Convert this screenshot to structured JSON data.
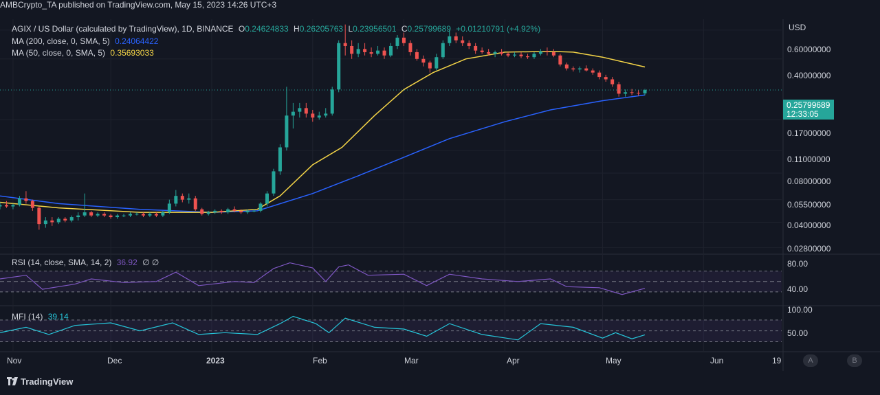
{
  "header": {
    "publish_text": "AMBCrypto_TA published on TradingView.com, May 15, 2023 14:26 UTC+3"
  },
  "legend": {
    "symbol": "AGIX / US Dollar (calculated by TradingView), 1D, BINANCE",
    "o_key": "O",
    "o_val": "0.24624833",
    "h_key": "H",
    "h_val": "0.26205763",
    "l_key": "L",
    "l_val": "0.23956501",
    "c_key": "C",
    "c_val": "0.25799689",
    "change": "+0.01210791 (+4.92%)",
    "ma200_label": "MA (200, close, 0, SMA, 5)",
    "ma200_val": "0.24064422",
    "ma50_label": "MA (50, close, 0, SMA, 5)",
    "ma50_val": "0.35693033"
  },
  "rsi": {
    "label": "RSI (14, close, SMA, 14, 2)",
    "value": "36.92",
    "extra": "∅ ∅"
  },
  "mfi": {
    "label": "MFI (14)",
    "value": "39.14"
  },
  "price_axis": {
    "currency": "USD",
    "ticks": [
      "0.60000000",
      "0.40000000",
      "0.17000000",
      "0.11000000",
      "0.08000000",
      "0.05500000",
      "0.04000000",
      "0.02800000"
    ],
    "current_price": "0.25799689",
    "countdown": "12:33:05"
  },
  "rsi_axis": {
    "ticks": [
      "80.00",
      "40.00"
    ]
  },
  "mfi_axis": {
    "ticks": [
      "100.00",
      "50.00"
    ]
  },
  "time_axis": {
    "ticks": [
      "Nov",
      "Dec",
      "2023",
      "Feb",
      "Mar",
      "Apr",
      "May",
      "Jun",
      "19"
    ]
  },
  "buttons": {
    "a": "A",
    "b": "B"
  },
  "branding": {
    "logo_text": "TradingView"
  },
  "colors": {
    "up": "#26a69a",
    "down": "#ef5350",
    "ma200": "#2962ff",
    "ma50": "#f5d547",
    "rsi": "#7e57c2",
    "mfi": "#26c6da",
    "background": "#131722"
  },
  "chart_data": {
    "type": "candlestick",
    "scale": "log",
    "ylim": [
      0.026,
      0.7
    ],
    "x_range": [
      "2022-10-28",
      "2023-06-25"
    ],
    "ohlc": [
      [
        "2022-10-28",
        0.05,
        0.053,
        0.048,
        0.051
      ],
      [
        "2022-10-30",
        0.051,
        0.054,
        0.049,
        0.05
      ],
      [
        "2022-11-01",
        0.05,
        0.052,
        0.048,
        0.051
      ],
      [
        "2022-11-03",
        0.051,
        0.058,
        0.05,
        0.056
      ],
      [
        "2022-11-05",
        0.056,
        0.062,
        0.052,
        0.054
      ],
      [
        "2022-11-07",
        0.054,
        0.055,
        0.047,
        0.049
      ],
      [
        "2022-11-09",
        0.049,
        0.05,
        0.036,
        0.039
      ],
      [
        "2022-11-11",
        0.039,
        0.043,
        0.037,
        0.041
      ],
      [
        "2022-11-13",
        0.041,
        0.043,
        0.038,
        0.04
      ],
      [
        "2022-11-15",
        0.04,
        0.043,
        0.039,
        0.042
      ],
      [
        "2022-11-17",
        0.042,
        0.043,
        0.04,
        0.041
      ],
      [
        "2022-11-19",
        0.041,
        0.044,
        0.04,
        0.043
      ],
      [
        "2022-11-21",
        0.043,
        0.046,
        0.041,
        0.044
      ],
      [
        "2022-11-23",
        0.044,
        0.06,
        0.043,
        0.046
      ],
      [
        "2022-11-25",
        0.046,
        0.047,
        0.043,
        0.044
      ],
      [
        "2022-11-27",
        0.044,
        0.046,
        0.043,
        0.045
      ],
      [
        "2022-11-29",
        0.045,
        0.046,
        0.043,
        0.044
      ],
      [
        "2022-12-01",
        0.044,
        0.045,
        0.042,
        0.043
      ],
      [
        "2022-12-03",
        0.043,
        0.045,
        0.042,
        0.044
      ],
      [
        "2022-12-05",
        0.044,
        0.045,
        0.043,
        0.044
      ],
      [
        "2022-12-07",
        0.044,
        0.046,
        0.043,
        0.045
      ],
      [
        "2022-12-09",
        0.045,
        0.046,
        0.044,
        0.045
      ],
      [
        "2022-12-11",
        0.045,
        0.046,
        0.043,
        0.044
      ],
      [
        "2022-12-13",
        0.044,
        0.046,
        0.043,
        0.045
      ],
      [
        "2022-12-15",
        0.045,
        0.046,
        0.043,
        0.044
      ],
      [
        "2022-12-17",
        0.044,
        0.047,
        0.043,
        0.046
      ],
      [
        "2022-12-19",
        0.046,
        0.055,
        0.045,
        0.052
      ],
      [
        "2022-12-21",
        0.052,
        0.063,
        0.05,
        0.058
      ],
      [
        "2022-12-23",
        0.058,
        0.06,
        0.053,
        0.055
      ],
      [
        "2022-12-25",
        0.055,
        0.06,
        0.052,
        0.056
      ],
      [
        "2022-12-27",
        0.056,
        0.058,
        0.047,
        0.048
      ],
      [
        "2022-12-29",
        0.048,
        0.049,
        0.044,
        0.045
      ],
      [
        "2022-12-31",
        0.045,
        0.047,
        0.044,
        0.046
      ],
      [
        "2023-01-02",
        0.046,
        0.048,
        0.045,
        0.047
      ],
      [
        "2023-01-04",
        0.047,
        0.048,
        0.045,
        0.046
      ],
      [
        "2023-01-06",
        0.046,
        0.049,
        0.045,
        0.048
      ],
      [
        "2023-01-08",
        0.048,
        0.05,
        0.046,
        0.047
      ],
      [
        "2023-01-10",
        0.047,
        0.048,
        0.045,
        0.046
      ],
      [
        "2023-01-12",
        0.046,
        0.048,
        0.045,
        0.047
      ],
      [
        "2023-01-14",
        0.047,
        0.048,
        0.046,
        0.047
      ],
      [
        "2023-01-16",
        0.047,
        0.053,
        0.046,
        0.052
      ],
      [
        "2023-01-18",
        0.052,
        0.062,
        0.05,
        0.06
      ],
      [
        "2023-01-20",
        0.06,
        0.085,
        0.058,
        0.082
      ],
      [
        "2023-01-22",
        0.082,
        0.12,
        0.078,
        0.115
      ],
      [
        "2023-01-24",
        0.115,
        0.27,
        0.11,
        0.18
      ],
      [
        "2023-01-26",
        0.18,
        0.215,
        0.15,
        0.19
      ],
      [
        "2023-01-28",
        0.19,
        0.215,
        0.175,
        0.2
      ],
      [
        "2023-01-30",
        0.2,
        0.215,
        0.175,
        0.185
      ],
      [
        "2023-02-01",
        0.185,
        0.195,
        0.165,
        0.175
      ],
      [
        "2023-02-03",
        0.175,
        0.19,
        0.17,
        0.18
      ],
      [
        "2023-02-05",
        0.18,
        0.2,
        0.175,
        0.185
      ],
      [
        "2023-02-07",
        0.185,
        0.27,
        0.18,
        0.26
      ],
      [
        "2023-02-09",
        0.26,
        0.52,
        0.25,
        0.5
      ],
      [
        "2023-02-11",
        0.5,
        0.65,
        0.42,
        0.48
      ],
      [
        "2023-02-13",
        0.48,
        0.52,
        0.4,
        0.43
      ],
      [
        "2023-02-15",
        0.43,
        0.5,
        0.41,
        0.46
      ],
      [
        "2023-02-17",
        0.46,
        0.5,
        0.42,
        0.44
      ],
      [
        "2023-02-19",
        0.44,
        0.47,
        0.41,
        0.43
      ],
      [
        "2023-02-21",
        0.43,
        0.48,
        0.42,
        0.45
      ],
      [
        "2023-02-23",
        0.45,
        0.47,
        0.4,
        0.42
      ],
      [
        "2023-02-25",
        0.42,
        0.5,
        0.41,
        0.48
      ],
      [
        "2023-02-27",
        0.48,
        0.56,
        0.46,
        0.54
      ],
      [
        "2023-03-01",
        0.54,
        0.58,
        0.48,
        0.5
      ],
      [
        "2023-03-03",
        0.5,
        0.52,
        0.42,
        0.44
      ],
      [
        "2023-03-05",
        0.44,
        0.46,
        0.39,
        0.4
      ],
      [
        "2023-03-07",
        0.4,
        0.42,
        0.36,
        0.38
      ],
      [
        "2023-03-09",
        0.38,
        0.39,
        0.33,
        0.35
      ],
      [
        "2023-03-11",
        0.35,
        0.43,
        0.34,
        0.41
      ],
      [
        "2023-03-13",
        0.41,
        0.52,
        0.4,
        0.5
      ],
      [
        "2023-03-15",
        0.5,
        0.6,
        0.48,
        0.55
      ],
      [
        "2023-03-17",
        0.55,
        0.58,
        0.5,
        0.52
      ],
      [
        "2023-03-19",
        0.52,
        0.55,
        0.48,
        0.5
      ],
      [
        "2023-03-21",
        0.5,
        0.52,
        0.46,
        0.48
      ],
      [
        "2023-03-23",
        0.48,
        0.5,
        0.43,
        0.45
      ],
      [
        "2023-03-25",
        0.45,
        0.47,
        0.43,
        0.44
      ],
      [
        "2023-03-27",
        0.44,
        0.46,
        0.42,
        0.43
      ],
      [
        "2023-03-29",
        0.43,
        0.45,
        0.41,
        0.44
      ],
      [
        "2023-03-31",
        0.44,
        0.46,
        0.42,
        0.43
      ],
      [
        "2023-04-02",
        0.43,
        0.44,
        0.41,
        0.42
      ],
      [
        "2023-04-04",
        0.42,
        0.44,
        0.41,
        0.425
      ],
      [
        "2023-04-06",
        0.425,
        0.44,
        0.405,
        0.415
      ],
      [
        "2023-04-08",
        0.415,
        0.43,
        0.4,
        0.41
      ],
      [
        "2023-04-10",
        0.41,
        0.44,
        0.4,
        0.43
      ],
      [
        "2023-04-12",
        0.43,
        0.46,
        0.42,
        0.445
      ],
      [
        "2023-04-14",
        0.445,
        0.47,
        0.42,
        0.44
      ],
      [
        "2023-04-16",
        0.44,
        0.46,
        0.41,
        0.42
      ],
      [
        "2023-04-18",
        0.42,
        0.43,
        0.36,
        0.37
      ],
      [
        "2023-04-20",
        0.37,
        0.38,
        0.34,
        0.35
      ],
      [
        "2023-04-22",
        0.35,
        0.36,
        0.335,
        0.345
      ],
      [
        "2023-04-24",
        0.345,
        0.36,
        0.33,
        0.35
      ],
      [
        "2023-04-26",
        0.35,
        0.365,
        0.335,
        0.34
      ],
      [
        "2023-04-28",
        0.34,
        0.35,
        0.32,
        0.33
      ],
      [
        "2023-04-30",
        0.33,
        0.34,
        0.3,
        0.31
      ],
      [
        "2023-05-02",
        0.31,
        0.32,
        0.29,
        0.3
      ],
      [
        "2023-05-04",
        0.3,
        0.31,
        0.27,
        0.28
      ],
      [
        "2023-05-06",
        0.28,
        0.29,
        0.235,
        0.245
      ],
      [
        "2023-05-08",
        0.245,
        0.26,
        0.235,
        0.25
      ],
      [
        "2023-05-10",
        0.25,
        0.262,
        0.24,
        0.248
      ],
      [
        "2023-05-12",
        0.248,
        0.258,
        0.238,
        0.246
      ],
      [
        "2023-05-14",
        0.24624833,
        0.26205763,
        0.23956501,
        0.25799689
      ]
    ],
    "ma200": [
      [
        "2022-10-28",
        0.058
      ],
      [
        "2022-11-15",
        0.052
      ],
      [
        "2022-12-10",
        0.048
      ],
      [
        "2023-01-01",
        0.046
      ],
      [
        "2023-01-15",
        0.047
      ],
      [
        "2023-02-01",
        0.06
      ],
      [
        "2023-02-15",
        0.077
      ],
      [
        "2023-03-01",
        0.1
      ],
      [
        "2023-03-15",
        0.13
      ],
      [
        "2023-04-01",
        0.165
      ],
      [
        "2023-04-15",
        0.195
      ],
      [
        "2023-05-01",
        0.222
      ],
      [
        "2023-05-14",
        0.24064422
      ]
    ],
    "ma50": [
      [
        "2022-10-28",
        0.053
      ],
      [
        "2022-11-15",
        0.049
      ],
      [
        "2022-12-10",
        0.046
      ],
      [
        "2023-01-01",
        0.046
      ],
      [
        "2023-01-15",
        0.048
      ],
      [
        "2023-01-22",
        0.058
      ],
      [
        "2023-02-01",
        0.09
      ],
      [
        "2023-02-10",
        0.115
      ],
      [
        "2023-02-20",
        0.18
      ],
      [
        "2023-03-01",
        0.26
      ],
      [
        "2023-03-10",
        0.33
      ],
      [
        "2023-03-20",
        0.4
      ],
      [
        "2023-04-01",
        0.44
      ],
      [
        "2023-04-15",
        0.445
      ],
      [
        "2023-04-22",
        0.44
      ],
      [
        "2023-05-01",
        0.41
      ],
      [
        "2023-05-14",
        0.35693033
      ]
    ],
    "rsi_series": [
      [
        "2022-10-28",
        55
      ],
      [
        "2022-11-05",
        62
      ],
      [
        "2022-11-10",
        35
      ],
      [
        "2022-11-20",
        45
      ],
      [
        "2022-11-25",
        55
      ],
      [
        "2022-12-05",
        48
      ],
      [
        "2022-12-15",
        50
      ],
      [
        "2022-12-21",
        68
      ],
      [
        "2022-12-28",
        42
      ],
      [
        "2023-01-08",
        50
      ],
      [
        "2023-01-14",
        48
      ],
      [
        "2023-01-20",
        75
      ],
      [
        "2023-01-25",
        86
      ],
      [
        "2023-02-01",
        76
      ],
      [
        "2023-02-05",
        50
      ],
      [
        "2023-02-09",
        78
      ],
      [
        "2023-02-12",
        82
      ],
      [
        "2023-02-18",
        62
      ],
      [
        "2023-03-01",
        64
      ],
      [
        "2023-03-08",
        42
      ],
      [
        "2023-03-15",
        64
      ],
      [
        "2023-03-25",
        55
      ],
      [
        "2023-04-05",
        50
      ],
      [
        "2023-04-15",
        55
      ],
      [
        "2023-04-20",
        40
      ],
      [
        "2023-04-30",
        38
      ],
      [
        "2023-05-07",
        25
      ],
      [
        "2023-05-14",
        36.92
      ]
    ],
    "mfi_series": [
      [
        "2022-10-28",
        45
      ],
      [
        "2022-11-05",
        60
      ],
      [
        "2022-11-12",
        40
      ],
      [
        "2022-11-20",
        65
      ],
      [
        "2022-12-01",
        72
      ],
      [
        "2022-12-10",
        50
      ],
      [
        "2022-12-20",
        72
      ],
      [
        "2022-12-28",
        40
      ],
      [
        "2023-01-05",
        45
      ],
      [
        "2023-01-15",
        40
      ],
      [
        "2023-01-22",
        70
      ],
      [
        "2023-01-26",
        90
      ],
      [
        "2023-02-02",
        70
      ],
      [
        "2023-02-06",
        45
      ],
      [
        "2023-02-11",
        85
      ],
      [
        "2023-02-20",
        60
      ],
      [
        "2023-03-01",
        55
      ],
      [
        "2023-03-08",
        35
      ],
      [
        "2023-03-15",
        70
      ],
      [
        "2023-03-25",
        40
      ],
      [
        "2023-04-05",
        25
      ],
      [
        "2023-04-12",
        70
      ],
      [
        "2023-04-22",
        60
      ],
      [
        "2023-05-01",
        30
      ],
      [
        "2023-05-05",
        45
      ],
      [
        "2023-05-10",
        28
      ],
      [
        "2023-05-14",
        39.14
      ]
    ],
    "rsi_levels": [
      70,
      50,
      30
    ],
    "mfi_levels": [
      80,
      50,
      20
    ]
  }
}
